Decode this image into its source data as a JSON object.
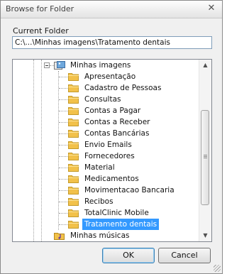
{
  "window": {
    "title": "Browse for Folder",
    "close_glyph": "✕"
  },
  "current_folder": {
    "label": "Current Folder",
    "path": "C:\\...\\Minhas imagens\\Tratamento dentais"
  },
  "tree": {
    "parent": "Minhas imagens",
    "children": [
      "Apresentação",
      "Cadastro de Pessoas",
      "Consultas",
      "Contas a Pagar",
      "Contas a Receber",
      "Contas Bancárias",
      "Envio Emails",
      "Fornecedores",
      "Material",
      "Medicamentos",
      "Movimentacao Bancaria",
      "Recibos",
      "TotalClinic Mobile",
      "Tratamento dentais"
    ],
    "selected": "Tratamento dentais",
    "next_sibling": "Minhas músicas"
  },
  "scrollbar": {
    "up_glyph": "▲",
    "down_glyph": "▼"
  },
  "buttons": {
    "ok": "OK",
    "cancel": "Cancel"
  },
  "colors": {
    "selection": "#3399ff",
    "folder": "#f2c14a"
  }
}
